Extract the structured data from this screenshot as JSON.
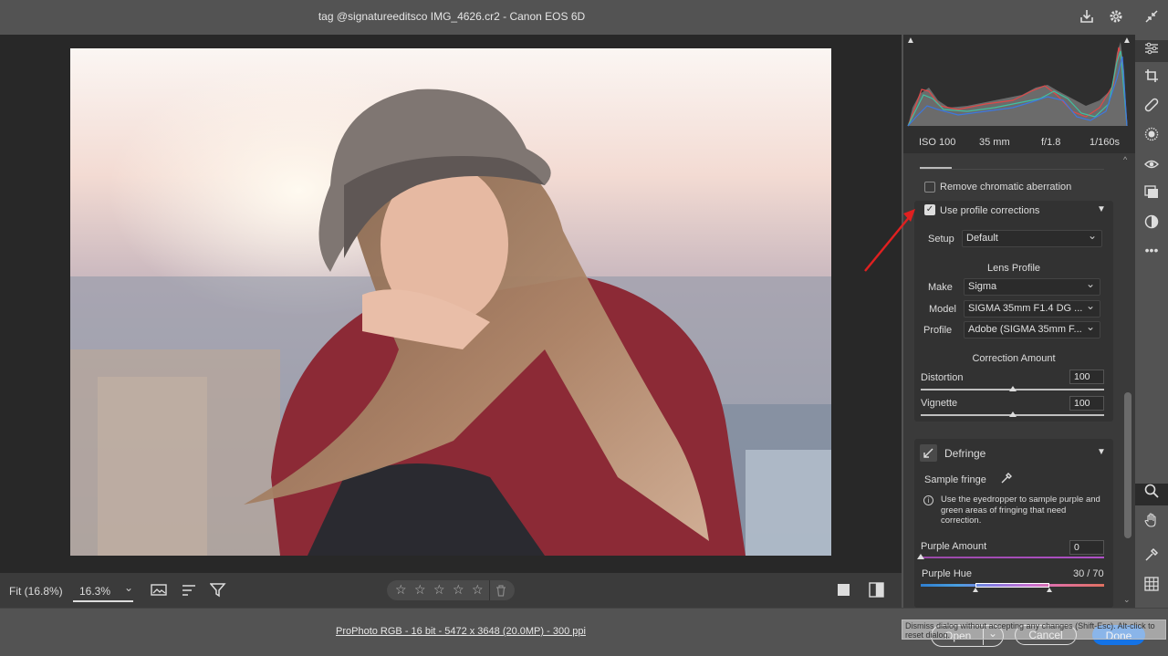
{
  "window": {
    "title": "tag @signatureeditsco IMG_4626.cr2  -  Canon EOS 6D"
  },
  "exif": {
    "iso": "ISO 100",
    "focal": "35 mm",
    "aperture": "f/1.8",
    "shutter": "1/160s"
  },
  "panel": {
    "remove_ca": "Remove chromatic aberration",
    "use_profile": "Use profile corrections",
    "setup_label": "Setup",
    "setup_value": "Default",
    "lens_profile_header": "Lens Profile",
    "make_label": "Make",
    "make_value": "Sigma",
    "model_label": "Model",
    "model_value": "SIGMA 35mm F1.4 DG ...",
    "profile_label": "Profile",
    "profile_value": "Adobe (SIGMA 35mm F...",
    "correction_header": "Correction Amount",
    "distortion_label": "Distortion",
    "distortion_value": "100",
    "vignette_label": "Vignette",
    "vignette_value": "100",
    "defringe_title": "Defringe",
    "sample_fringe": "Sample fringe",
    "defringe_info": "Use the eyedropper to sample purple and green areas of fringing that need correction.",
    "purple_amount_label": "Purple Amount",
    "purple_amount_value": "0",
    "purple_hue_label": "Purple Hue",
    "purple_hue_value": "30 / 70"
  },
  "levels": {
    "distortion": 100,
    "vignette": 100,
    "purple_amount": 0,
    "purple_hue_min": 30,
    "purple_hue_max": 70
  },
  "bottom": {
    "fit_label": "Fit (16.8%)",
    "zoom_value": "16.3%"
  },
  "status": {
    "workflow": "ProPhoto RGB - 16 bit - 5472 x 3648 (20.0MP) - 300 ppi",
    "tooltip": "Dismiss dialog without accepting any changes (Shift-Esc). Alt-click to reset dialog.",
    "open_label": "Open",
    "cancel_label": "Cancel",
    "done_label": "Done"
  },
  "icons": {
    "save": "save-icon",
    "settings": "gear-icon",
    "fullscreen": "collapse-icon"
  },
  "colors": {
    "accent": "#1473e6",
    "panel": "#3a3a3a",
    "background": "#535353"
  }
}
